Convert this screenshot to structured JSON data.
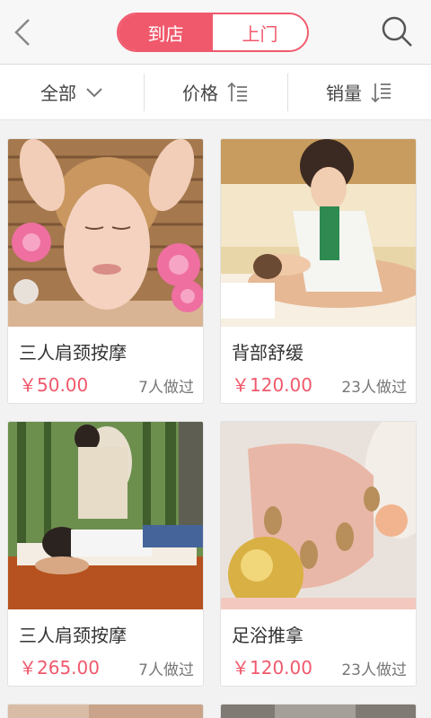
{
  "header": {
    "tabs": [
      {
        "label": "到店",
        "active": true
      },
      {
        "label": "上门",
        "active": false
      }
    ]
  },
  "filters": [
    {
      "label": "全部",
      "icon": "chevron-down-icon"
    },
    {
      "label": "价格",
      "icon": "sort-ascending-icon"
    },
    {
      "label": "销量",
      "icon": "sort-descending-icon"
    }
  ],
  "products": [
    {
      "title": "三人肩颈按摩",
      "price": "￥50.00",
      "sold": "7人做过",
      "image": "facial-massage-photo"
    },
    {
      "title": "背部舒缓",
      "price": "￥120.00",
      "sold": "23人做过",
      "image": "back-massage-photo"
    },
    {
      "title": "三人肩颈按摩",
      "price": "￥265.00",
      "sold": "7人做过",
      "image": "shoulder-massage-photo"
    },
    {
      "title": "足浴推拿",
      "price": "￥120.00",
      "sold": "23人做过",
      "image": "nail-care-photo"
    }
  ],
  "colors": {
    "accent": "#f0596c",
    "text": "#333333",
    "muted": "#777777"
  }
}
